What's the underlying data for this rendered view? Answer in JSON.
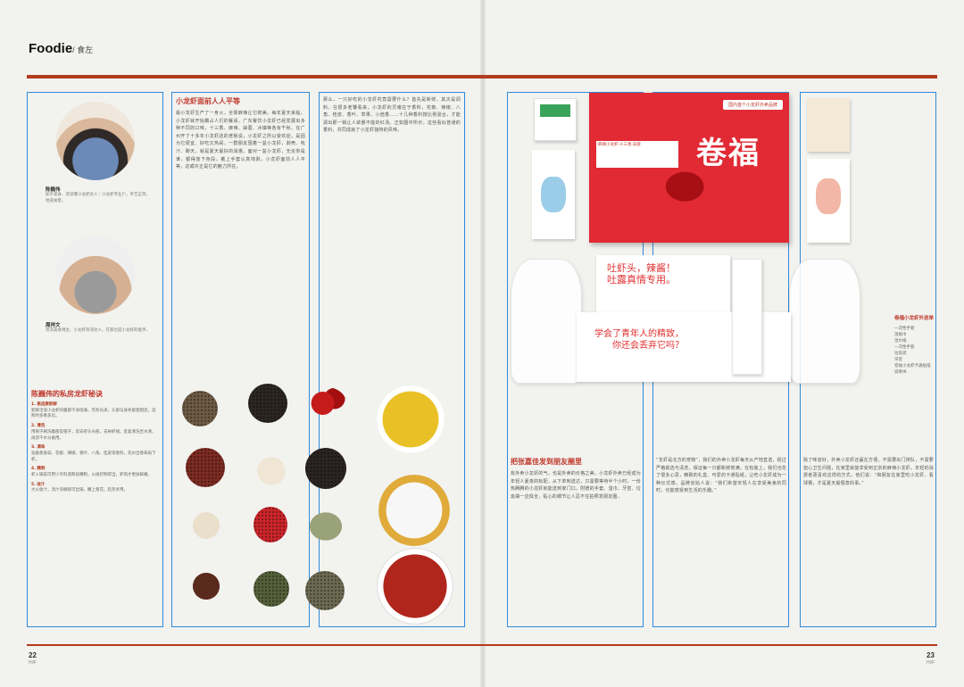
{
  "header": {
    "brand": "Foodie",
    "sub": "/ 食左"
  },
  "left_page": {
    "page_number": "22",
    "page_sub": "Hi!F",
    "person1": {
      "name": "陈巍伟",
      "bio": "知乎美食、资深爆小龙虾达人｜小龙虾专业户，手艺正宗，地道食客。"
    },
    "person2": {
      "name": "周祥文",
      "bio": "资深美食博主、小龙虾资深达人，在家也是小龙虾的能手。"
    },
    "tips_title": "陈巍伟的私房龙虾秘诀",
    "tips": [
      {
        "head": "1. 挑选要趁鲜",
        "body": "新鲜活泼小龙虾的腹部干净饱满，壳有光泽，头部与身体紧密相连，选购时多看多比。"
      },
      {
        "head": "2. 清洗",
        "body": "用刷子刷洗腹部及钳子，剪去虾头尖部，去掉虾线。反复清洗至水清，再沥干水分备用。"
      },
      {
        "head": "3. 调味",
        "body": "准备葱姜蒜、花椒、辣椒、香叶、八角、桂皮等香料，先炒出香味再下虾。"
      },
      {
        "head": "4. 腌制",
        "body": "虾入锅前可用少许料酒和盐腌制，火候控制得当，虾肉才更加鲜嫩。"
      },
      {
        "head": "5. 收汁",
        "body": "大火收汁，汤汁浓稠即可出锅，撒上葱花，趁热享用。"
      }
    ],
    "col2_title": "小龙虾面前人人平等",
    "col2_text": "最小龙虾生产了一身火，全靠麻辣让它鲜美。每年夏天来临，小龙虾就开始霸占人们的餐桌。广东餐饮小龙虾已经发展出多种不同的口味，十三香、麻辣、蒜蓉、冰镇等各有千秋。在广州开了十多年小龙虾店的老板说，小龙虾之所以受欢迎，是因为它便宜、好吃又热闹，一群朋友围着一盆小龙虾，剥壳、吮汁、聊天，就是夏天最好的消遣。面对一盆小龙虾，无论你是谁，都得放下身段，戴上手套认真地剥。小龙虾面前人人平等，这或许正是它的魅力所在。",
    "col3_text": "那么，一只好吃的小龙虾究竟需要什么？首先是新鲜，其次是调料。在很多老饕看来，小龙虾的灵魂在于香料，花椒、辣椒、八角、桂皮、香叶、草果、小茴香……十几种香料按比例混合，才能调出那一锅让人欲罢不能的红汤。正如图中所示，这些看似普通的香料，共同成就了小龙虾独特的风味。"
  },
  "right_page": {
    "page_number": "23",
    "page_sub": "Hi!F",
    "box_brand": "卷福",
    "box_label": "国内首个小龙虾外卖品牌",
    "box_line": "麻辣小龙虾·十三香·蒜蓉",
    "card_line1": "吐虾头，辣酱！",
    "card_line2": "吐露真情专用。",
    "card_line3": "学会了青年人的精致，",
    "card_line4": "你还会丢弃它吗？",
    "tag_title": "卷福小龙虾外送单",
    "tag_items": [
      "一次性手套",
      "湿纸巾",
      "湿巾纸",
      "一次性手套",
      "垃圾袋",
      "牙签",
      "卷福小龙虾卡通贴纸",
      "说明书"
    ],
    "col4_title": "把张嘉佳发到朋友圈里",
    "col4_text": "有外卖小龙虾的气，也是外卖的价格之美。小龙虾外卖已经成为年轻人夏夜的标配，从下单到送达，只需要等待半个小时，一份热腾腾的小龙虾就能送到家门口。附赠的手套、湿巾、牙签、垃圾袋一应俱全，贴心的细节让人忍不住拍照发朋友圈。",
    "col5_text": "“龙虾是北方的宠物”，我们的外卖小龙虾每天从产地直送，经过严格挑选与清洗，保证每一只都新鲜饱满。在包装上，我们也花了很多心思，精致的礼盒、可爱的卡通贴纸，让吃小龙虾成为一种仪式感。品牌创始人说：“我们希望年轻人在享受美食的同时，也能感受到生活的乐趣。”",
    "col6_text": "除了味道好，外卖小龙虾还赢在方便。不需要出门排队，不需要担心卫生问题，在家里就能享受到正宗的麻辣小龙虾。年轻的消费者更喜欢这样的方式，他们说：“和朋友在家里吃小龙虾、看球赛，才是夏天最惬意的事。”"
  }
}
